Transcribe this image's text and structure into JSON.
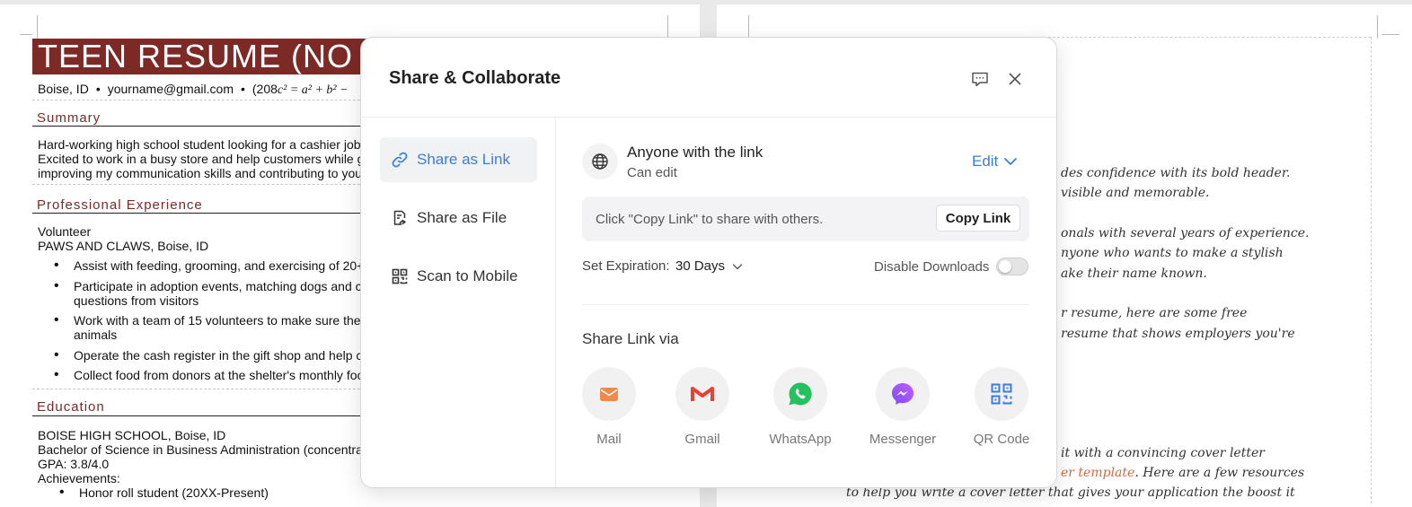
{
  "resume": {
    "title": "TEEN RESUME (NO",
    "contact": {
      "location": "Boise, ID",
      "email": "yourname@gmail.com",
      "phone_prefix": "(208",
      "phone_math": "c² = a² + b² −"
    },
    "summary_heading": "Summary",
    "summary_lines": [
      "Hard-working high school student looking for a cashier job",
      "Excited to work in a busy store and help customers while g",
      "improving my communication skills and contributing to you"
    ],
    "experience_heading": "Professional Experience",
    "role": "Volunteer",
    "org": "PAWS AND CLAWS, Boise, ID",
    "bullets": [
      "Assist with feeding, grooming, and exercising of 20+",
      "Participate in adoption events, matching dogs and c",
      "questions from visitors",
      "Work with a team of 15 volunteers to make sure the",
      "animals",
      "Operate the cash register in the gift shop and help c",
      "Collect food from donors at the shelter's monthly foo"
    ],
    "education_heading": "Education",
    "education_lines": [
      "BOISE HIGH SCHOOL, Boise, ID",
      "Bachelor of Science in Business Administration (concentra",
      "GPA: 3.8/4.0",
      "Achievements:"
    ],
    "achievement_bullet": "Honor roll student (20XX-Present)"
  },
  "right_page": {
    "lines": [
      "des confidence with its bold header.",
      "visible and memorable.",
      "onals with several years of experience.",
      "nyone who wants to make a stylish",
      "ake their name known.",
      "r resume, here are some free",
      "resume that shows employers you're",
      "it with a convincing cover letter",
      ". Here are a few resources",
      "to help you write a cover letter that gives your application the boost it"
    ],
    "link_text": "er template"
  },
  "dialog": {
    "title": "Share & Collaborate",
    "feedback_icon": "comment-icon",
    "close_icon": "close-icon",
    "sidebar": {
      "items": [
        {
          "label": "Share as Link",
          "icon": "link-icon",
          "active": true
        },
        {
          "label": "Share as File",
          "icon": "file-share-icon",
          "active": false
        },
        {
          "label": "Scan to Mobile",
          "icon": "qr-code-icon",
          "active": false
        }
      ]
    },
    "permission": {
      "title": "Anyone with the link",
      "subtitle": "Can edit",
      "edit_label": "Edit"
    },
    "copy": {
      "hint": "Click \"Copy Link\" to share with others.",
      "button": "Copy Link"
    },
    "expiration": {
      "label": "Set Expiration:",
      "value": "30 Days"
    },
    "downloads": {
      "label": "Disable Downloads",
      "enabled": false
    },
    "share_via": {
      "title": "Share Link via",
      "options": [
        {
          "label": "Mail",
          "icon": "mail-icon",
          "color": "#f08a4b"
        },
        {
          "label": "Gmail",
          "icon": "gmail-icon",
          "color": "#e94235"
        },
        {
          "label": "WhatsApp",
          "icon": "whatsapp-icon",
          "color": "#25c15f"
        },
        {
          "label": "Messenger",
          "icon": "messenger-icon",
          "color": "#8a4dff"
        },
        {
          "label": "QR Code",
          "icon": "qr-code-icon",
          "color": "#3b7ddd"
        }
      ]
    }
  },
  "colors": {
    "accent": "#3b7ddd",
    "resume_header": "#7d2a27"
  }
}
